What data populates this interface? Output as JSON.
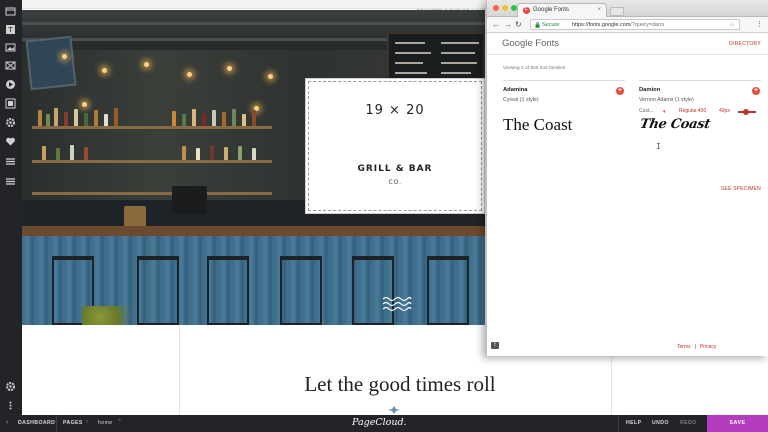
{
  "canvas": {
    "layout_label": "DESKTOP & TABLET LAYOUT"
  },
  "card": {
    "logo": "19 × 20",
    "title": "GRILL & BAR",
    "subtitle": "CO."
  },
  "page": {
    "headline": "Let the good times roll"
  },
  "browser": {
    "tab_title": "Google Fonts",
    "tab_close": "×",
    "secure_label": "Secure",
    "url_host": "https://fonts.google.com",
    "url_path": "/?query=dami",
    "gf_logo": "Google Fonts",
    "directory": "DIRECTORY",
    "count": "Viewing 2 of 900 font families",
    "families": [
      {
        "name": "Adamina",
        "meta": "Cyreal (1 style)",
        "sample": "The Coast"
      },
      {
        "name": "Damion",
        "meta": "Vernon Adams (1 style)",
        "sample": "The Coast"
      }
    ],
    "controls": {
      "preset": "Cust...",
      "style": "Regular 400",
      "size": "40px"
    },
    "see_specimen": "SEE SPECIMEN",
    "footer": {
      "terms": "Terms",
      "separator": "|",
      "privacy": "Privacy"
    },
    "feedback": "!"
  },
  "bottom_bar": {
    "dashboard": "DASHBOARD",
    "pages": "PAGES",
    "current_page": "home",
    "brand": "PageCloud.",
    "help": "HELP",
    "undo": "UNDO",
    "redo": "REDO",
    "save": "SAVE"
  },
  "colors": {
    "accent_red": "#c5302c",
    "save_purple": "#b23bbe",
    "toolbar_dark": "#232428"
  }
}
